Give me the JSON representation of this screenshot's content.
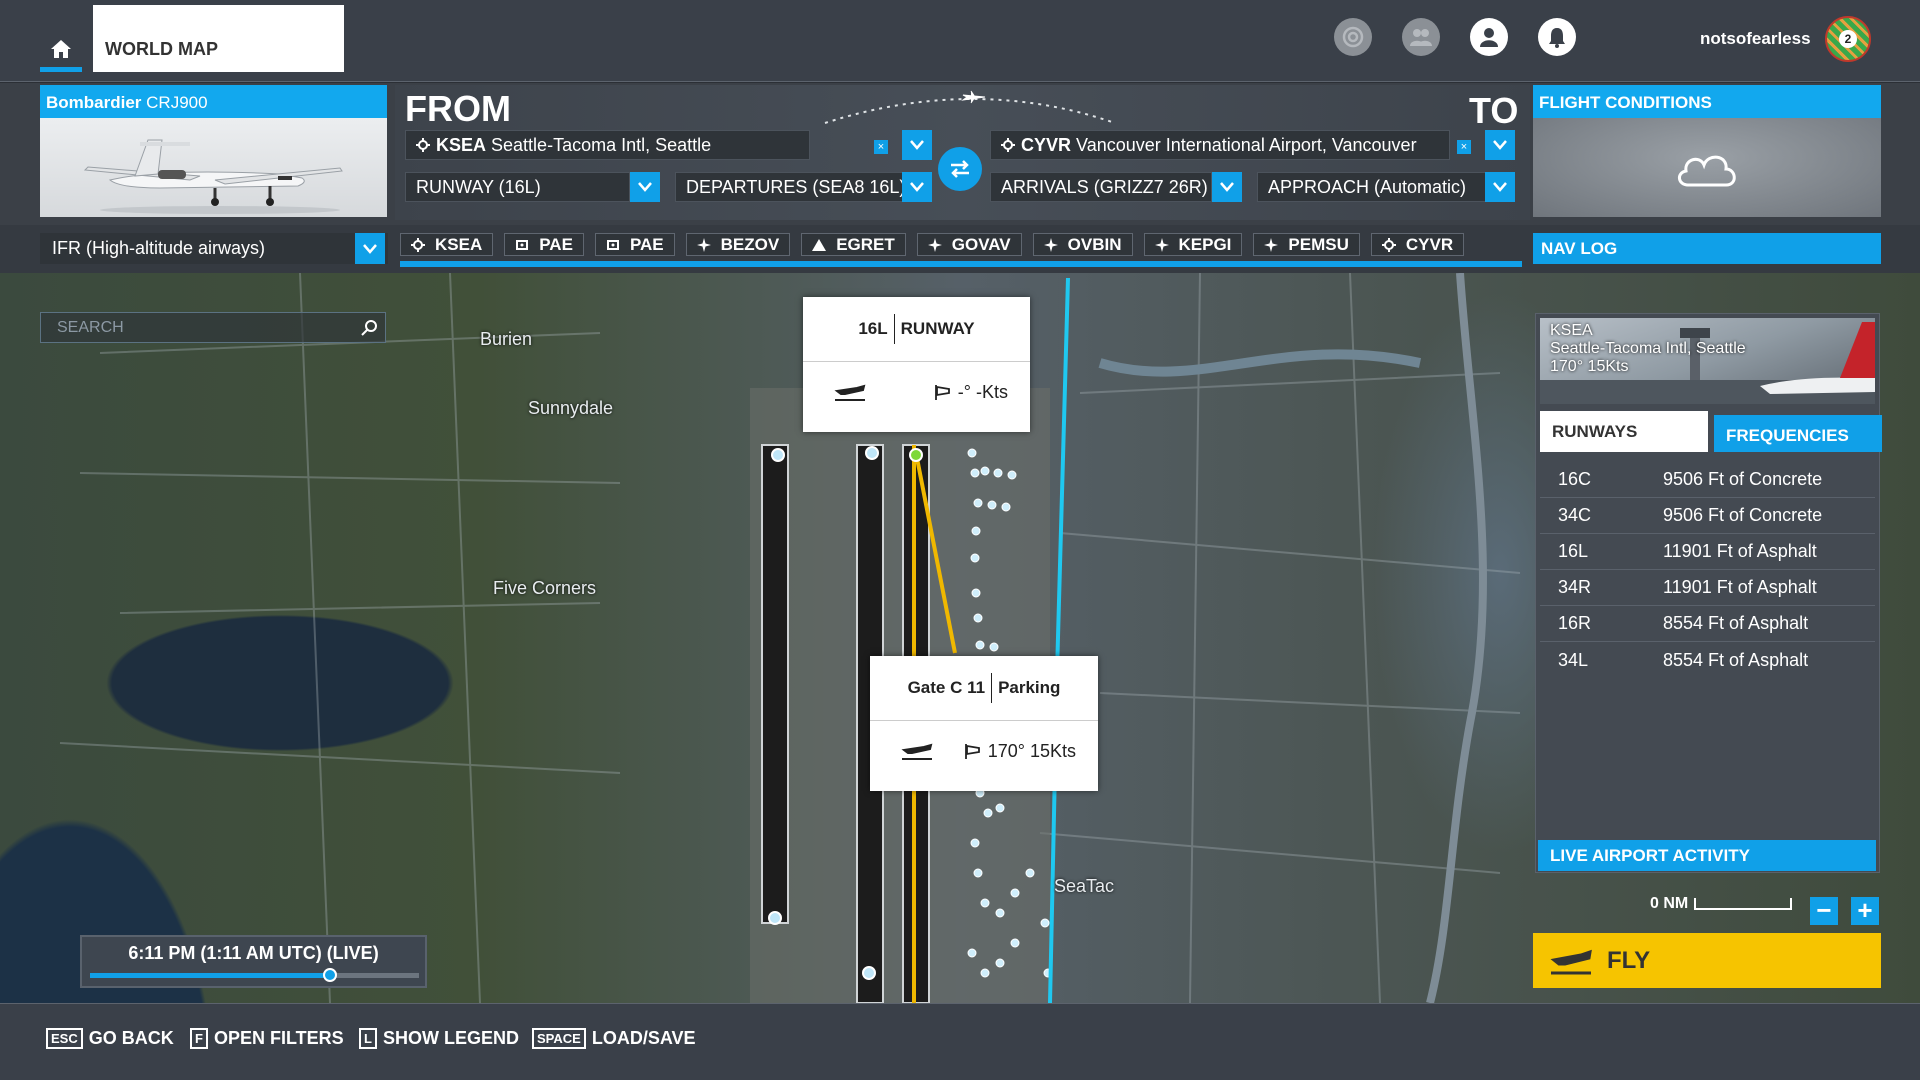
{
  "nav": {
    "world_map": "WORLD MAP",
    "username": "notsofearless",
    "avatar_badge": "2"
  },
  "aircraft": {
    "brand": "Bombardier",
    "model": "CRJ900"
  },
  "from_to": {
    "from_label": "FROM",
    "to_label": "TO",
    "from_airport_code": "KSEA",
    "from_airport_name": "Seattle-Tacoma Intl, Seattle",
    "to_airport_code": "CYVR",
    "to_airport_name": "Vancouver International Airport, Vancouver",
    "runway": "RUNWAY (16L)",
    "departure": "DEPARTURES (SEA8 16L)",
    "arrival": "ARRIVALS (GRIZZ7 26R)",
    "approach": "APPROACH (Automatic)"
  },
  "flight_conditions": {
    "title": "FLIGHT CONDITIONS",
    "icon": "cloud-icon"
  },
  "route": {
    "flight_type": "IFR (High-altitude airways)",
    "waypoints": [
      {
        "id": "KSEA",
        "icon": "airport-icon"
      },
      {
        "id": "PAE",
        "icon": "vor-icon"
      },
      {
        "id": "PAE",
        "icon": "vor-icon"
      },
      {
        "id": "BEZOV",
        "icon": "fix-icon"
      },
      {
        "id": "EGRET",
        "icon": "triangle-icon"
      },
      {
        "id": "GOVAV",
        "icon": "fix-icon"
      },
      {
        "id": "OVBIN",
        "icon": "fix-icon"
      },
      {
        "id": "KEPGI",
        "icon": "fix-icon"
      },
      {
        "id": "PEMSU",
        "icon": "fix-icon"
      },
      {
        "id": "CYVR",
        "icon": "airport-icon"
      }
    ]
  },
  "nav_log": "NAV LOG",
  "search": {
    "placeholder": "SEARCH"
  },
  "map_labels": {
    "burien": "Burien",
    "sunnydale": "Sunnydale",
    "five_corners": "Five Corners",
    "seatac": "SeaTac"
  },
  "runway_popup": {
    "id": "16L",
    "type": "RUNWAY",
    "wind": "-° -Kts"
  },
  "gate_popup": {
    "id": "Gate C 11",
    "type": "Parking",
    "wind": "170° 15Kts"
  },
  "airport_panel": {
    "code": "KSEA",
    "name": "Seattle-Tacoma Intl, Seattle",
    "wind": "170° 15Kts",
    "tab_runways": "RUNWAYS",
    "tab_frequencies": "FREQUENCIES",
    "runways": [
      {
        "id": "16C",
        "desc": "9506 Ft of Concrete"
      },
      {
        "id": "34C",
        "desc": "9506 Ft of Concrete"
      },
      {
        "id": "16L",
        "desc": "11901 Ft of Asphalt"
      },
      {
        "id": "34R",
        "desc": "11901 Ft of Asphalt"
      },
      {
        "id": "16R",
        "desc": "8554 Ft of Asphalt"
      },
      {
        "id": "34L",
        "desc": "8554 Ft of Asphalt"
      }
    ],
    "live_activity": "LIVE AIRPORT ACTIVITY"
  },
  "map_scale": "0 NM",
  "fly": "FLY",
  "time": {
    "label": "6:11 PM (1:11 AM UTC) (LIVE)",
    "slider_fraction": 0.73
  },
  "bottom_hints": [
    {
      "key": "ESC",
      "label": "GO BACK"
    },
    {
      "key": "F",
      "label": "OPEN FILTERS"
    },
    {
      "key": "L",
      "label": "SHOW LEGEND"
    },
    {
      "key": "SPACE",
      "label": "LOAD/SAVE"
    }
  ],
  "colors": {
    "accent": "#10a0e8",
    "fly": "#f6c400",
    "route": "#1fc8f0"
  }
}
